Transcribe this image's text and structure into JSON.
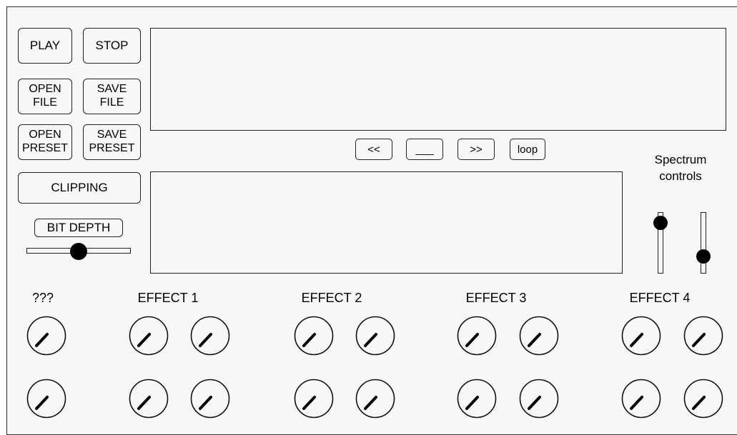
{
  "buttons": {
    "play": "PLAY",
    "stop": "STOP",
    "open_file": "OPEN\nFILE",
    "save_file": "SAVE\nFILE",
    "open_preset": "OPEN\nPRESET",
    "save_preset": "SAVE\nPRESET",
    "clipping": "CLIPPING"
  },
  "bit_depth": {
    "label": "BIT DEPTH",
    "value_fraction": 0.5
  },
  "transport": {
    "rewind": "<<",
    "stop": "___",
    "forward": ">>",
    "loop": "loop"
  },
  "spectrum": {
    "title": "Spectrum\ncontrols",
    "slider1_fraction": 0.82,
    "slider2_fraction": 0.28
  },
  "effects": {
    "unknown": "???",
    "effect1": "EFFECT 1",
    "effect2": "EFFECT 2",
    "effect3": "EFFECT 3",
    "effect4": "EFFECT 4"
  },
  "colors": {
    "background": "#f7f7f7",
    "border": "#222222",
    "thumb": "#000000"
  }
}
